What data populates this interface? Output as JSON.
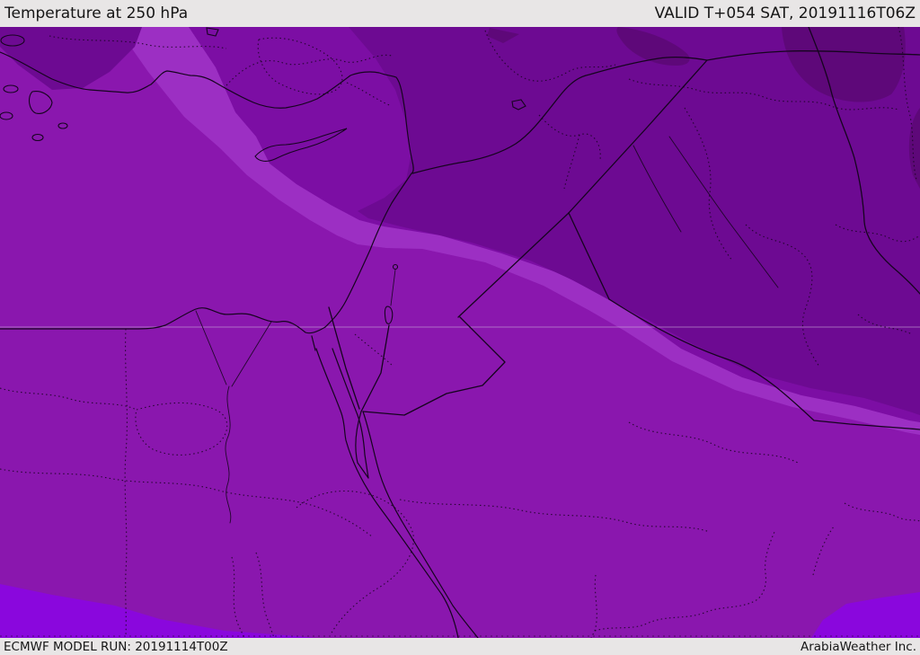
{
  "header": {
    "title": "Temperature at 250 hPa",
    "valid_label": "VALID T+054 SAT, 20191116T06Z"
  },
  "footer": {
    "model_run_label": "ECMWF MODEL RUN: 20191114T00Z",
    "brand_label": "ArabiaWeather Inc."
  },
  "map": {
    "colors": {
      "bar_bg": "#e8e6e6",
      "bar_text": "#161616",
      "base_medium": "#8a17ae",
      "band_light": "#9c2fc3",
      "band_middark": "#7c0ea4",
      "band_dark": "#6d0a92",
      "band_darkest": "#5e0879",
      "band_violet": "#8a07dd",
      "line": "#16041f",
      "graticule": "#cdb6d8"
    }
  }
}
